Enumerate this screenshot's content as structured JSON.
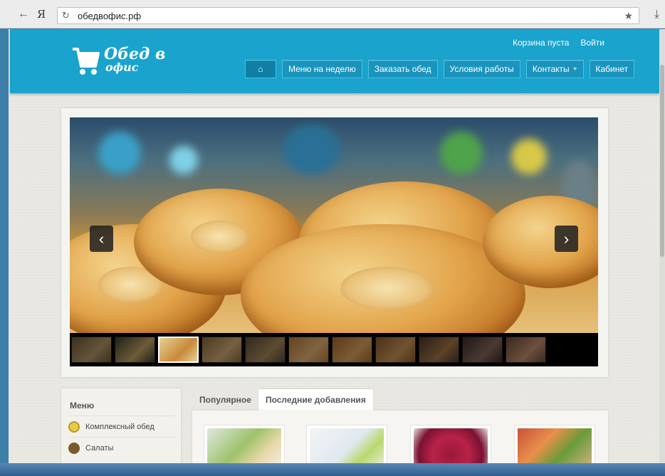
{
  "browser": {
    "logo": "Я",
    "url": "обедвофис.рф"
  },
  "brand": {
    "line1": "Обед в",
    "line2": "офис"
  },
  "top_links": {
    "cart": "Корзина пуста",
    "login": "Войти"
  },
  "nav": {
    "menu_week": "Меню на неделю",
    "order": "Заказать обед",
    "terms": "Условия работы",
    "contacts": "Контакты",
    "contacts_plus": "+",
    "cabinet": "Кабинет"
  },
  "slider": {
    "thumb_count": 11,
    "active_thumb": 2
  },
  "sidebar": {
    "title": "Меню",
    "items": [
      {
        "label": "Комплексный обед",
        "icon_color": "#e8c948"
      },
      {
        "label": "Салаты",
        "icon_color": "#7a5a2a"
      }
    ]
  },
  "tabs": {
    "popular": "Популярное",
    "latest": "Последние добавления"
  },
  "colors": {
    "header": "#19a3cd",
    "nav_button": "#1b94bd"
  }
}
